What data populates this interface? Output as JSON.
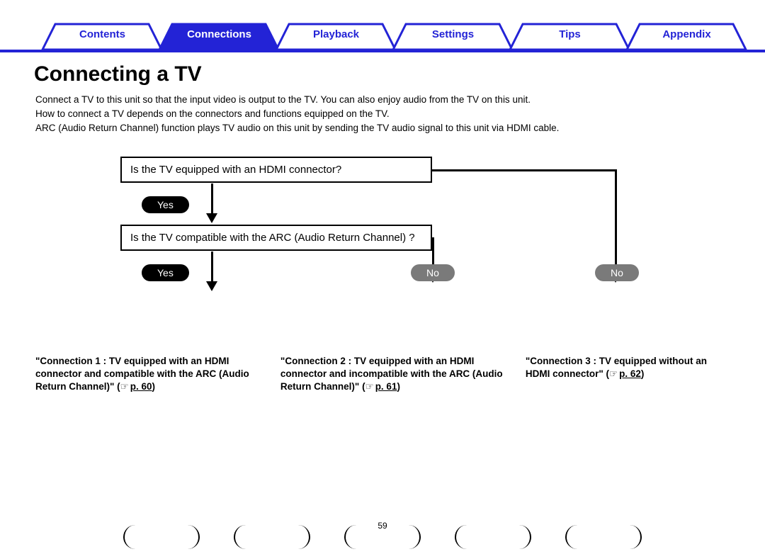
{
  "tabs": {
    "items": [
      {
        "label": "Contents",
        "active": false
      },
      {
        "label": "Connections",
        "active": true
      },
      {
        "label": "Playback",
        "active": false
      },
      {
        "label": "Settings",
        "active": false
      },
      {
        "label": "Tips",
        "active": false
      },
      {
        "label": "Appendix",
        "active": false
      }
    ]
  },
  "heading": "Connecting a TV",
  "intro": {
    "p1": "Connect a TV to this unit so that the input video is output to the TV. You can also enjoy audio from the TV on this unit.",
    "p2": "How to connect a TV depends on the connectors and functions equipped on the TV.",
    "p3": "ARC (Audio Return Channel) function plays TV audio on this unit by sending the TV audio signal to this unit via HDMI cable."
  },
  "flow": {
    "q1": "Is the TV equipped with an HDMI connector?",
    "q2": "Is the TV compatible with the ARC (Audio Return Channel) ?",
    "yes": "Yes",
    "no": "No"
  },
  "results": {
    "r1_prefix": "\"Connection 1 : TV equipped with an HDMI connector and compatible with the ARC (Audio Return Channel)\" (",
    "r1_link": "p. 60",
    "r1_suffix": ")",
    "r2_prefix": "\"Connection 2 : TV equipped with an HDMI connector and incompatible with the ARC (Audio Return Channel)\" (",
    "r2_link": "p. 61",
    "r2_suffix": ")",
    "r3_prefix": "\"Connection 3 : TV equipped without an HDMI connector\" (",
    "r3_link": "p. 62",
    "r3_suffix": ")",
    "hand_icon": "☞"
  },
  "page_number": "59"
}
